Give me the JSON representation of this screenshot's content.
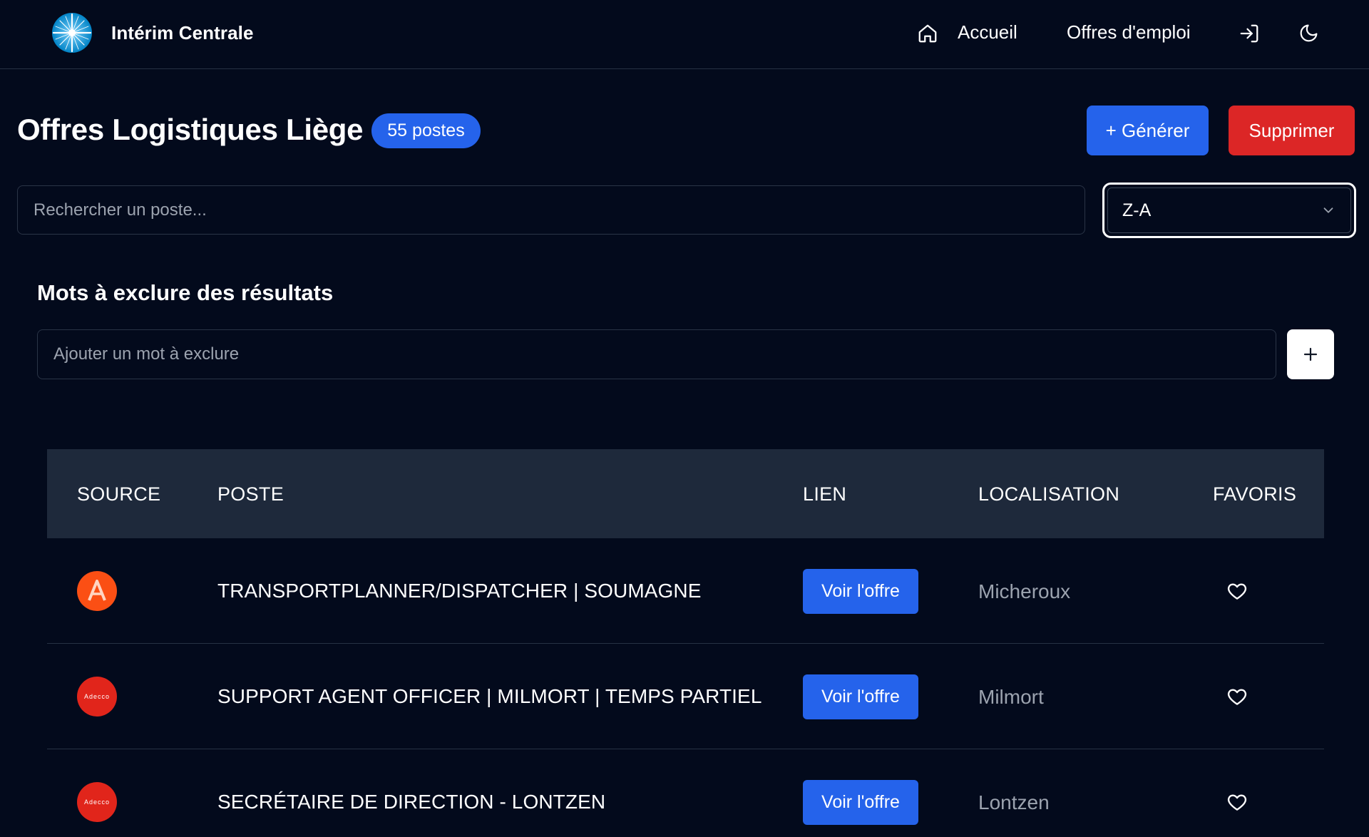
{
  "header": {
    "brand_name": "Intérim Centrale",
    "logo_icon": "compass-burst-logo",
    "nav": {
      "home_icon": "home-icon",
      "accueil_label": "Accueil",
      "offres_label": "Offres d'emploi",
      "login_icon": "login-icon",
      "theme_icon": "moon-icon"
    }
  },
  "page": {
    "title": "Offres Logistiques Liège",
    "count_badge": "55 postes",
    "generate_label": "+ Générer",
    "delete_label": "Supprimer"
  },
  "search": {
    "placeholder": "Rechercher un poste...",
    "value": ""
  },
  "sort": {
    "selected": "Z-A"
  },
  "exclude": {
    "title": "Mots à exclure des résultats",
    "placeholder": "Ajouter un mot à exclure",
    "value": "",
    "add_icon": "plus-icon"
  },
  "table": {
    "headers": {
      "source": "SOURCE",
      "poste": "POSTE",
      "lien": "LIEN",
      "localisation": "LOCALISATION",
      "favoris": "FAVORIS"
    },
    "rows": [
      {
        "source": "A",
        "source_logo": "a-logo",
        "title": "TRANSPORTPLANNER/DISPATCHER | SOUMAGNE",
        "link_label": "Voir l'offre",
        "location": "Micheroux",
        "favorite": false
      },
      {
        "source": "Adecco",
        "source_logo": "adecco-logo",
        "title": "SUPPORT AGENT OFFICER | MILMORT | TEMPS PARTIEL",
        "link_label": "Voir l'offre",
        "location": "Milmort",
        "favorite": false
      },
      {
        "source": "Adecco",
        "source_logo": "adecco-logo",
        "title": "SECRÉTAIRE DE DIRECTION - LONTZEN",
        "link_label": "Voir l'offre",
        "location": "Lontzen",
        "favorite": false
      }
    ]
  },
  "colors": {
    "background": "#030a1c",
    "primary": "#2563eb",
    "danger": "#dc2626",
    "table_header": "#1e293b",
    "muted_text": "#9ca3af"
  }
}
